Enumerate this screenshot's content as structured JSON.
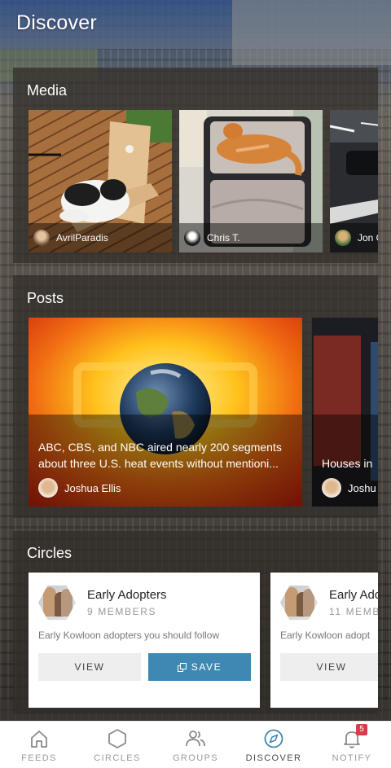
{
  "header": {
    "title": "Discover"
  },
  "media": {
    "title": "Media",
    "items": [
      {
        "author": "AvrilParadis",
        "image": "cat-on-wooden-deck"
      },
      {
        "author": "Chris T.",
        "image": "cat-in-suitcase"
      },
      {
        "author": "Jon C",
        "image": "parking-garage"
      }
    ]
  },
  "posts": {
    "title": "Posts",
    "items": [
      {
        "text": "ABC, CBS, and NBC aired nearly 200 segments about three U.S. heat events without mentioni...",
        "author": "Joshua Ellis",
        "image": "globe-on-heat-map"
      },
      {
        "text": "Houses in",
        "author": "Joshu",
        "image": "house-photo"
      }
    ]
  },
  "circles": {
    "title": "Circles",
    "items": [
      {
        "name": "Early Adopters",
        "members": "9 MEMBERS",
        "description": "Early Kowloon adopters you should follow",
        "view_label": "VIEW",
        "save_label": "SAVE"
      },
      {
        "name": "Early Adc",
        "members": "11 MEMB",
        "description": "Early Kowloon adopt",
        "view_label": "VIEW"
      }
    ]
  },
  "nav": {
    "items": [
      {
        "label": "FEEDS",
        "icon": "home-icon"
      },
      {
        "label": "CIRCLES",
        "icon": "hexagon-icon"
      },
      {
        "label": "GROUPS",
        "icon": "people-icon"
      },
      {
        "label": "DISCOVER",
        "icon": "compass-icon",
        "active": true
      },
      {
        "label": "NOTIFY",
        "icon": "bell-icon",
        "badge": "5"
      }
    ]
  },
  "colors": {
    "accent": "#3f88b4",
    "badge": "#d93b4a",
    "active_nav": "#3f88b4"
  }
}
